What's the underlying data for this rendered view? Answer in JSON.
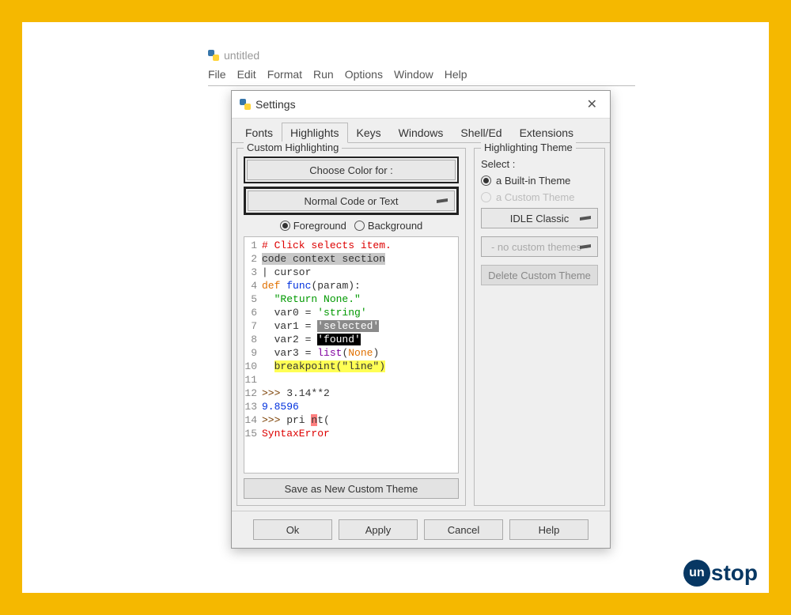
{
  "idle_window": {
    "title": "untitled",
    "menu": [
      "File",
      "Edit",
      "Format",
      "Run",
      "Options",
      "Window",
      "Help"
    ]
  },
  "dialog": {
    "title": "Settings",
    "tabs": [
      "Fonts",
      "Highlights",
      "Keys",
      "Windows",
      "Shell/Ed",
      "Extensions"
    ],
    "active_tab": "Highlights",
    "left": {
      "legend": "Custom Highlighting",
      "choose_label": "Choose Color for :",
      "element_select": "Normal Code or Text",
      "fg_label": "Foreground",
      "bg_label": "Background",
      "fg_selected": true,
      "save_btn": "Save as New Custom Theme"
    },
    "sample_lines": [
      {
        "n": 1,
        "segs": [
          {
            "t": "# Click selects item.",
            "cls": "tok-comment"
          }
        ]
      },
      {
        "n": 2,
        "segs": [
          {
            "t": "code context section",
            "cls": "tok-context"
          }
        ]
      },
      {
        "n": 3,
        "segs": [
          {
            "t": "| cursor",
            "cls": ""
          }
        ]
      },
      {
        "n": 4,
        "segs": [
          {
            "t": "def",
            "cls": "tok-kw"
          },
          {
            "t": " ",
            "cls": ""
          },
          {
            "t": "func",
            "cls": "tok-def"
          },
          {
            "t": "(param):",
            "cls": ""
          }
        ]
      },
      {
        "n": 5,
        "segs": [
          {
            "t": "  ",
            "cls": ""
          },
          {
            "t": "\"Return None.\"",
            "cls": "tok-str"
          }
        ]
      },
      {
        "n": 6,
        "segs": [
          {
            "t": "  var0 = ",
            "cls": ""
          },
          {
            "t": "'string'",
            "cls": "tok-str"
          }
        ]
      },
      {
        "n": 7,
        "segs": [
          {
            "t": "  var1 = ",
            "cls": ""
          },
          {
            "t": "'selected'",
            "cls": "tok-sel"
          }
        ]
      },
      {
        "n": 8,
        "segs": [
          {
            "t": "  var2 = ",
            "cls": ""
          },
          {
            "t": "'found'",
            "cls": "tok-found"
          }
        ]
      },
      {
        "n": 9,
        "segs": [
          {
            "t": "  var3 = ",
            "cls": ""
          },
          {
            "t": "list",
            "cls": "tok-builtin"
          },
          {
            "t": "(",
            "cls": ""
          },
          {
            "t": "None",
            "cls": "tok-kw"
          },
          {
            "t": ")",
            "cls": ""
          }
        ]
      },
      {
        "n": 10,
        "segs": [
          {
            "t": "  ",
            "cls": ""
          },
          {
            "t": "breakpoint(\"line\")",
            "cls": "tok-bp"
          }
        ]
      },
      {
        "n": 11,
        "segs": [
          {
            "t": "",
            "cls": ""
          }
        ]
      },
      {
        "n": 12,
        "segs": [
          {
            "t": ">>>",
            "cls": "tok-prompt"
          },
          {
            "t": " 3.14**2",
            "cls": ""
          }
        ]
      },
      {
        "n": 13,
        "segs": [
          {
            "t": "9.8596",
            "cls": "tok-out"
          }
        ]
      },
      {
        "n": 14,
        "segs": [
          {
            "t": ">>>",
            "cls": "tok-prompt"
          },
          {
            "t": " pri ",
            "cls": ""
          },
          {
            "t": "n",
            "cls": "tok-errchar"
          },
          {
            "t": "t(",
            "cls": ""
          }
        ]
      },
      {
        "n": 15,
        "segs": [
          {
            "t": "SyntaxError",
            "cls": "tok-err"
          }
        ]
      }
    ],
    "right": {
      "legend": "Highlighting Theme",
      "select_label": "Select :",
      "builtin_label": "a Built-in Theme",
      "custom_label": "a Custom Theme",
      "builtin_selected": true,
      "builtin_combo": "IDLE Classic",
      "custom_combo": "- no custom themes -",
      "delete_btn": "Delete Custom Theme"
    },
    "footer": {
      "ok": "Ok",
      "apply": "Apply",
      "cancel": "Cancel",
      "help": "Help"
    }
  },
  "logo": {
    "bubble": "un",
    "rest": "stop"
  }
}
